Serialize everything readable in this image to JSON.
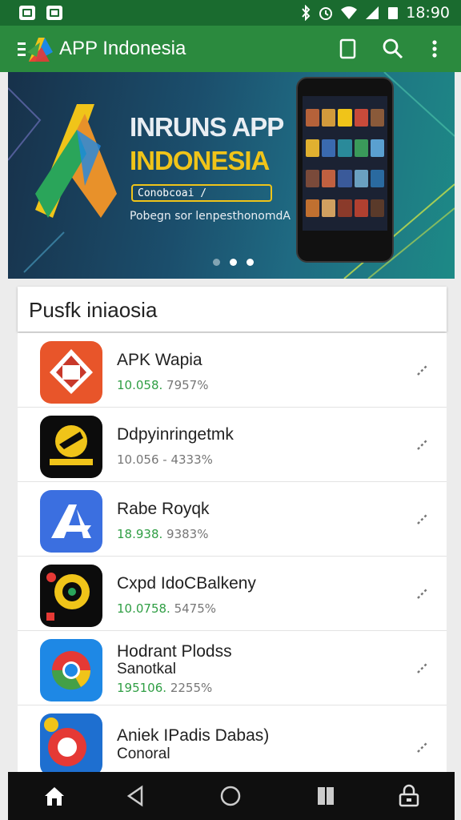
{
  "status_bar": {
    "time": "18:90"
  },
  "app_bar": {
    "title": "APP Indonesia",
    "actions": [
      "bookmark-icon",
      "search-icon",
      "more-vert-icon"
    ]
  },
  "banner": {
    "title_line1": "INRUNS APP",
    "title_line2": "INDONESIA",
    "button_label": "Conobcoai /",
    "subtitle": "Pobegn sor lenpesthonomdA",
    "page_indicator": {
      "count": 3,
      "active": 2
    }
  },
  "section": {
    "title": "Pusfk iniaosia"
  },
  "apps": [
    {
      "name": "APK Wapia",
      "name_line2": "",
      "meta_green": "10.058.",
      "meta_gray": "7957%",
      "meta_green_colored": true,
      "icon": "orange-badge-icon"
    },
    {
      "name": "Ddpyinringetmk",
      "name_line2": "",
      "meta_green": "10.056 -",
      "meta_gray": "4333%",
      "meta_green_colored": false,
      "icon": "yellow-emblem-icon"
    },
    {
      "name": "Rabe Royqk",
      "name_line2": "",
      "meta_green": "18.938.",
      "meta_gray": "9383%",
      "meta_green_colored": true,
      "icon": "blue-a-icon"
    },
    {
      "name": "Cxpd IdoCBalkeny",
      "name_line2": "",
      "meta_green": "10.0758.",
      "meta_gray": "5475%",
      "meta_green_colored": true,
      "icon": "dark-gauge-icon"
    },
    {
      "name": "Hodrant Plodss",
      "name_line2": "Sanotkal",
      "meta_green": "195106.",
      "meta_gray": "2255%",
      "meta_green_colored": true,
      "icon": "chrome-icon"
    },
    {
      "name": "Aniek IPadis Dabas)",
      "name_line2": "Conoral",
      "meta_green": "",
      "meta_gray": "",
      "meta_green_colored": true,
      "icon": "red-circle-icon"
    }
  ],
  "colors": {
    "status_bar": "#1a6b2f",
    "app_bar": "#2b8a3e",
    "accent_yellow": "#f0c419",
    "meta_green": "#2f9e44"
  },
  "nav": [
    "home-icon",
    "back-icon",
    "home-circle-icon",
    "recents-icon",
    "lock-icon"
  ]
}
